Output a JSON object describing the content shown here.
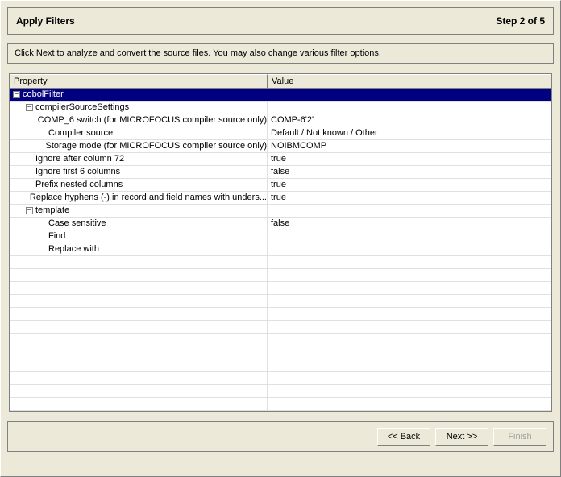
{
  "header": {
    "title": "Apply Filters",
    "step": "Step 2 of 5"
  },
  "description": "Click Next to analyze and convert the source files. You may also change various filter options.",
  "columns": {
    "property": "Property",
    "value": "Value"
  },
  "tree": [
    {
      "depth": 0,
      "expander": "minus",
      "label": "cobolFilter",
      "value": "",
      "selected": true
    },
    {
      "depth": 1,
      "expander": "minus",
      "label": "compilerSourceSettings",
      "value": ""
    },
    {
      "depth": 2,
      "expander": "",
      "label": "COMP_6 switch (for MICROFOCUS compiler source only)",
      "value": "COMP-6'2'"
    },
    {
      "depth": 2,
      "expander": "",
      "label": "Compiler source",
      "value": "Default / Not known / Other"
    },
    {
      "depth": 2,
      "expander": "",
      "label": "Storage mode (for MICROFOCUS compiler source only)",
      "value": "NOIBMCOMP"
    },
    {
      "depth": 1,
      "expander": "",
      "label": "Ignore after column 72",
      "value": "true"
    },
    {
      "depth": 1,
      "expander": "",
      "label": "Ignore first 6 columns",
      "value": "false"
    },
    {
      "depth": 1,
      "expander": "",
      "label": "Prefix nested columns",
      "value": "true"
    },
    {
      "depth": 1,
      "expander": "",
      "label": "Replace hyphens (-) in record and field names with unders...",
      "value": "true"
    },
    {
      "depth": 1,
      "expander": "minus",
      "label": "template",
      "value": ""
    },
    {
      "depth": 2,
      "expander": "",
      "label": "Case sensitive",
      "value": "false"
    },
    {
      "depth": 2,
      "expander": "",
      "label": "Find",
      "value": ""
    },
    {
      "depth": 2,
      "expander": "",
      "label": "Replace with",
      "value": ""
    }
  ],
  "blank_rows": 12,
  "buttons": {
    "back": "<< Back",
    "next": "Next >>",
    "finish": "Finish"
  }
}
